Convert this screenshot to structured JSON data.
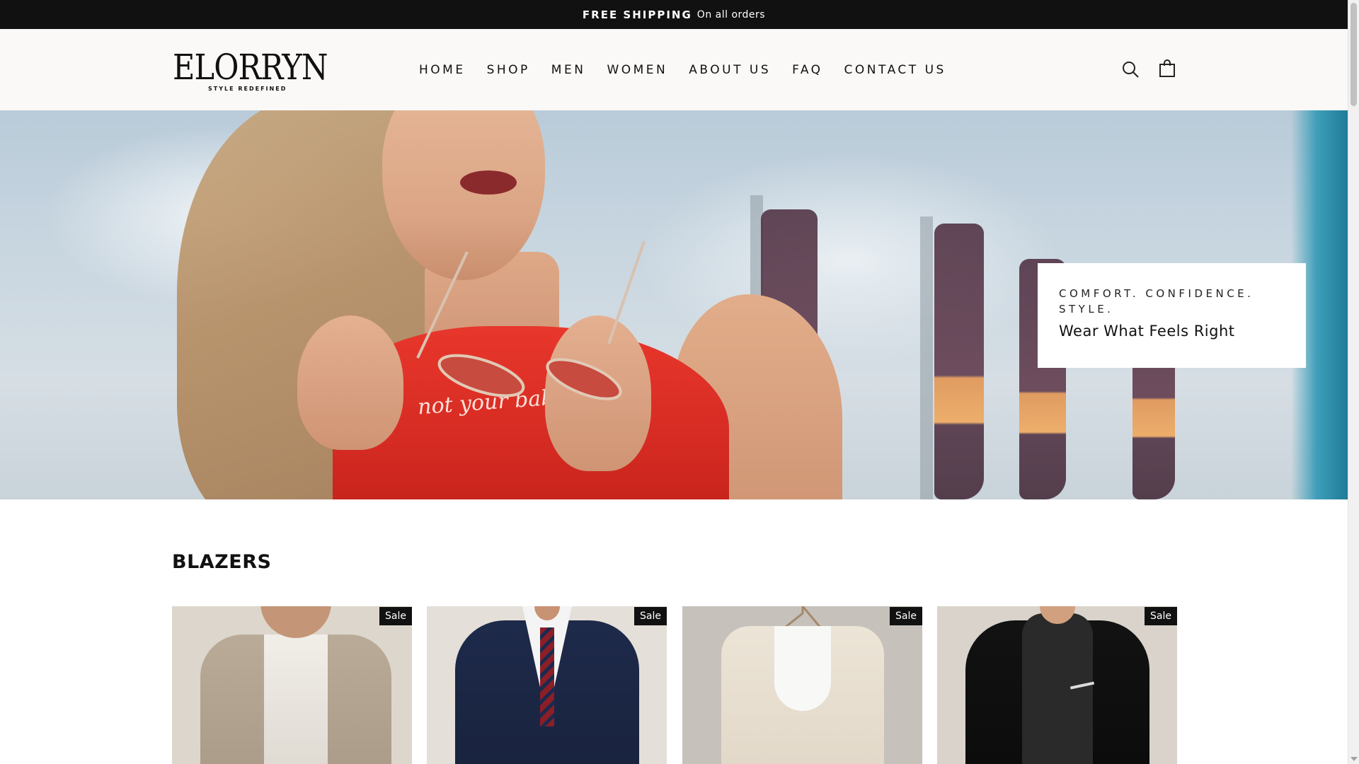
{
  "announcement": {
    "strong": "FREE SHIPPING",
    "light": "On all orders"
  },
  "brand": {
    "name": "ELORRYN",
    "tagline": "STYLE REDEFINED"
  },
  "nav": {
    "items": [
      {
        "label": "HOME"
      },
      {
        "label": "SHOP"
      },
      {
        "label": "MEN"
      },
      {
        "label": "WOMEN"
      },
      {
        "label": "ABOUT US"
      },
      {
        "label": "FAQ"
      },
      {
        "label": "CONTACT US"
      }
    ]
  },
  "header_icons": {
    "search": "search-icon",
    "cart": "shopping-bag-icon"
  },
  "hero": {
    "eyebrow_line1": "COMFORT. CONFIDENCE.",
    "eyebrow_line2": "STYLE.",
    "headline": "Wear What Feels Right",
    "shirt_text": "not your baby"
  },
  "section": {
    "title": "BLAZERS"
  },
  "products": [
    {
      "badge": "Sale"
    },
    {
      "badge": "Sale"
    },
    {
      "badge": "Sale"
    },
    {
      "badge": "Sale"
    }
  ],
  "colors": {
    "announcement_bg": "#111111",
    "header_bg": "#faf9f7",
    "badge_bg": "#111111",
    "accent_red": "#d42a22"
  }
}
